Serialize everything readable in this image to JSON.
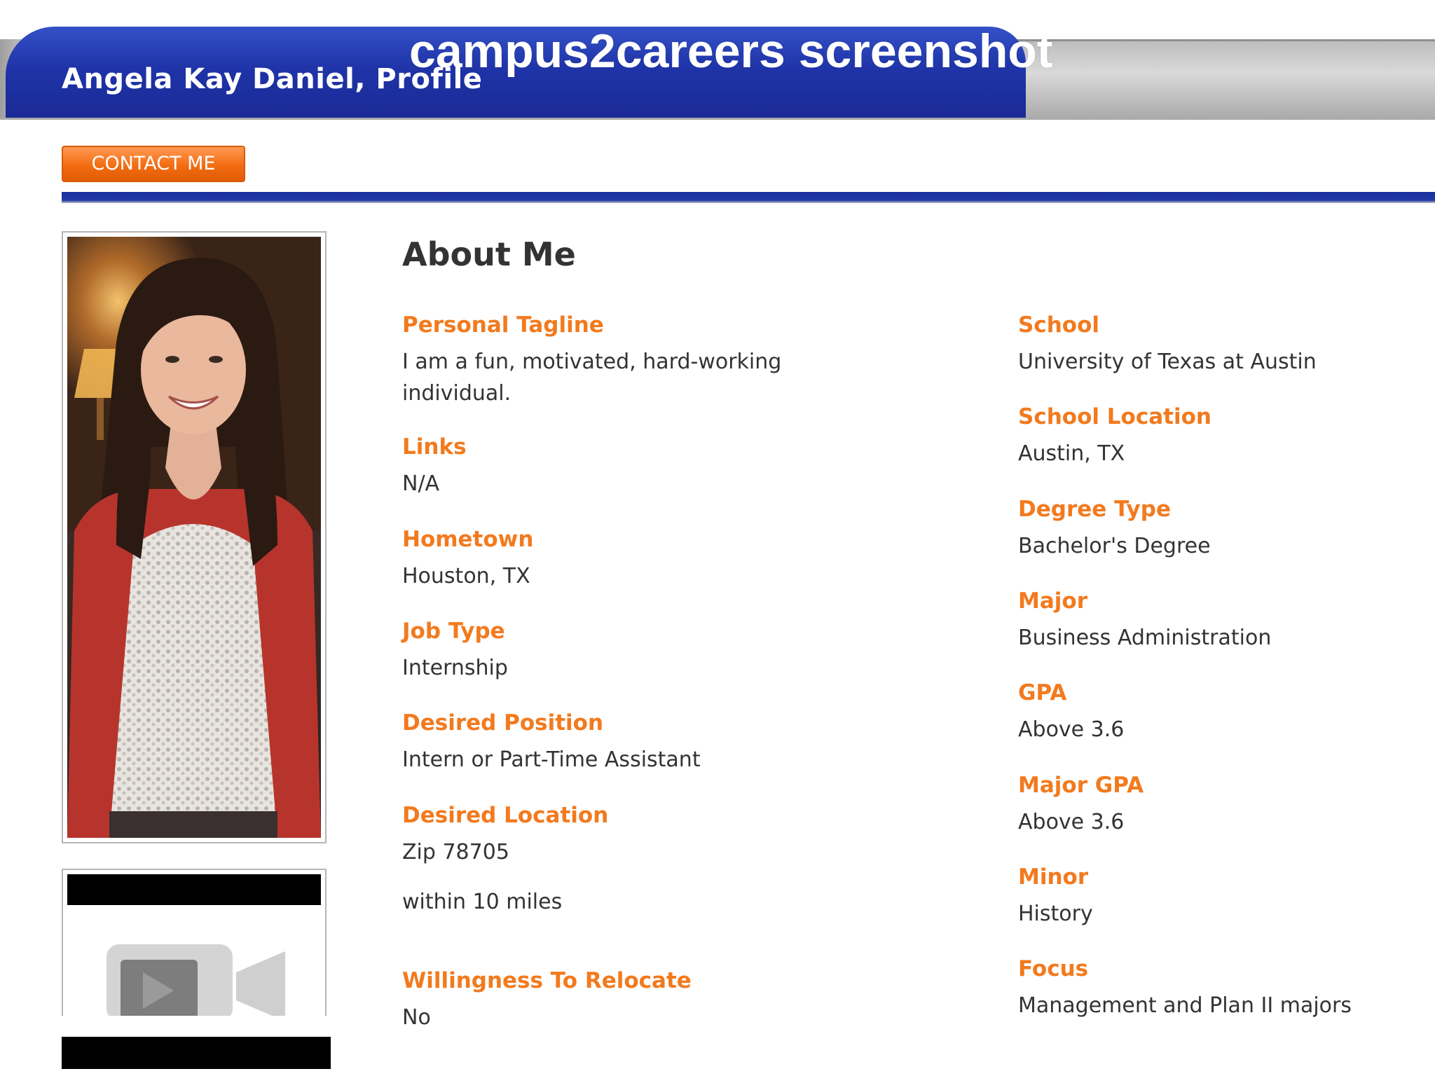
{
  "header": {
    "profile_title": "Angela Kay Daniel, Profile",
    "watermark": "campus2careers screenshot"
  },
  "actions": {
    "contact_label": "CONTACT ME"
  },
  "colors": {
    "header_blue": "#1f34a8",
    "accent_orange": "#f27a1e",
    "button_orange": "#f36c12",
    "text": "#333333"
  },
  "photo": {
    "icon": "profile-photo"
  },
  "video": {
    "icon": "video-camera-icon"
  },
  "about": {
    "heading": "About Me",
    "left": [
      {
        "label": "Personal Tagline",
        "value": "I am a fun, motivated, hard-working individual."
      },
      {
        "label": "Links",
        "value": "N/A"
      },
      {
        "label": "Hometown",
        "value": "Houston, TX"
      },
      {
        "label": "Job Type",
        "value": "Internship"
      },
      {
        "label": "Desired Position",
        "value": "Intern or Part-Time Assistant"
      },
      {
        "label": "Desired Location",
        "value": "Zip 78705",
        "extra": "within 10 miles"
      },
      {
        "label": "Willingness To Relocate",
        "value": "No"
      }
    ],
    "right": [
      {
        "label": "School",
        "value": "University of Texas at Austin"
      },
      {
        "label": "School Location",
        "value": "Austin, TX"
      },
      {
        "label": "Degree Type",
        "value": "Bachelor's Degree"
      },
      {
        "label": "Major",
        "value": "Business Administration"
      },
      {
        "label": "GPA",
        "value": "Above 3.6"
      },
      {
        "label": "Major GPA",
        "value": "Above 3.6"
      },
      {
        "label": "Minor",
        "value": "History"
      },
      {
        "label": "Focus",
        "value": "Management and Plan II majors"
      }
    ]
  }
}
